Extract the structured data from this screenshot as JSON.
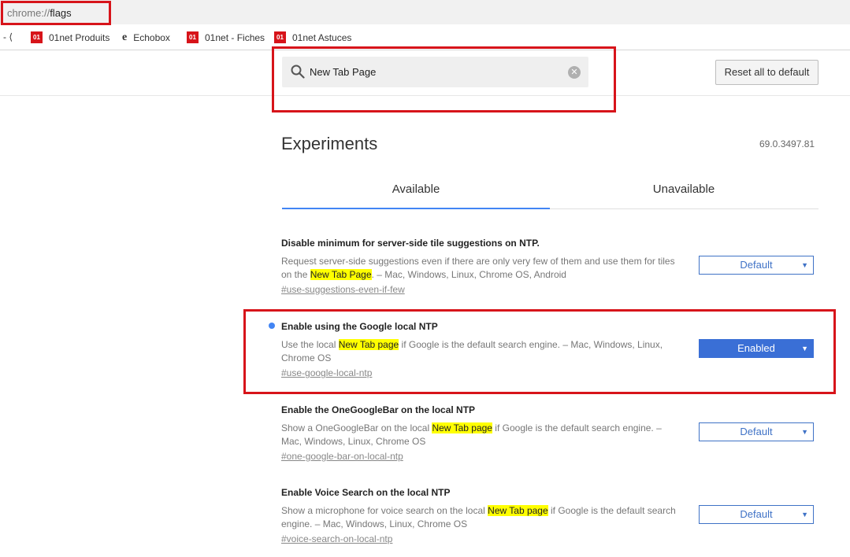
{
  "omnibox": {
    "scheme": "chrome://",
    "path": "flags"
  },
  "bookmarks": [
    {
      "label": "i - ⟨",
      "icon": "partial-text"
    },
    {
      "label": "01net Produits",
      "icon": "01net-favicon"
    },
    {
      "label": "Echobox",
      "icon": "echobox-favicon"
    },
    {
      "label": "01net - Fiches",
      "icon": "01net-favicon"
    },
    {
      "label": "01net Astuces",
      "icon": "01net-favicon"
    }
  ],
  "favicon_text": "01",
  "search": {
    "query": "New Tab Page",
    "clear_glyph": "✕"
  },
  "reset_button": "Reset all to default",
  "page_title": "Experiments",
  "version": "69.0.3497.81",
  "tabs": {
    "available": "Available",
    "unavailable": "Unavailable"
  },
  "experiments": [
    {
      "name": "Disable minimum for server-side tile suggestions on NTP.",
      "desc_before": "Request server-side suggestions even if there are only very few of them and use them for tiles on the ",
      "highlight": "New Tab Page",
      "desc_after": ". – Mac, Windows, Linux, Chrome OS, Android",
      "tag": "#use-suggestions-even-if-few",
      "state": "Default"
    },
    {
      "name": "Enable using the Google local NTP",
      "desc_before": "Use the local ",
      "highlight": "New Tab page",
      "desc_after": " if Google is the default search engine. – Mac, Windows, Linux, Chrome OS",
      "tag": "#use-google-local-ntp",
      "state": "Enabled"
    },
    {
      "name": "Enable the OneGoogleBar on the local NTP",
      "desc_before": "Show a OneGoogleBar on the local ",
      "highlight": "New Tab page",
      "desc_after": " if Google is the default search engine. – Mac, Windows, Linux, Chrome OS",
      "tag": "#one-google-bar-on-local-ntp",
      "state": "Default"
    },
    {
      "name": "Enable Voice Search on the local NTP",
      "desc_before": "Show a microphone for voice search on the local ",
      "highlight": "New Tab page",
      "desc_after": " if Google is the default search engine. – Mac, Windows, Linux, Chrome OS",
      "tag": "#voice-search-on-local-ntp",
      "state": "Default"
    }
  ],
  "select_arrow": "▼",
  "colors": {
    "annotation_red": "#d7141a",
    "accent_blue": "#4285f4",
    "enabled_blue": "#3a6fd6",
    "highlight": "#ffff00"
  }
}
